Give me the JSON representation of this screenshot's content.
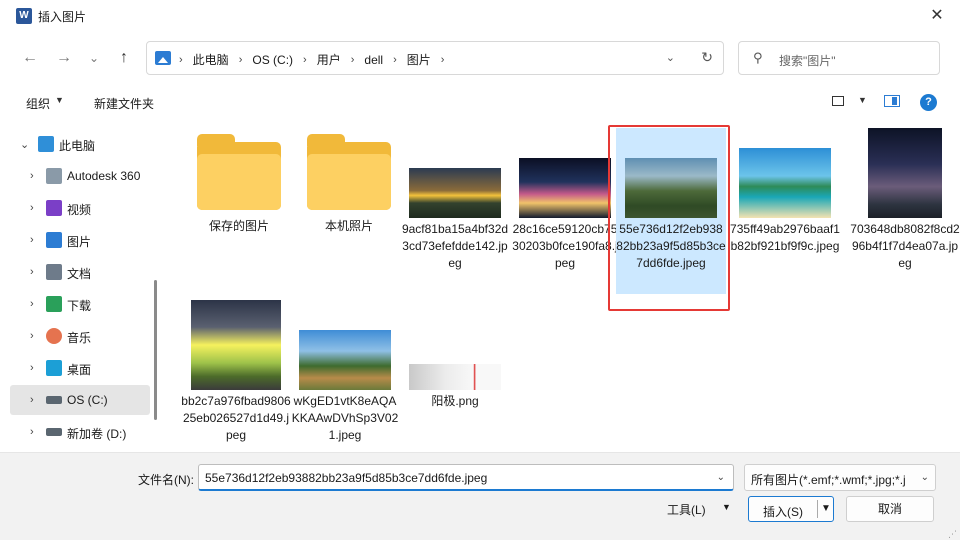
{
  "window": {
    "title": "插入图片",
    "app_icon": "W",
    "close_glyph": "✕"
  },
  "nav": {
    "back_glyph": "←",
    "forward_glyph": "→",
    "recent_glyph": "⌄",
    "up_glyph": "↑",
    "breadcrumb": [
      "此电脑",
      "OS (C:)",
      "用户",
      "dell",
      "图片"
    ],
    "separator": "›",
    "dropdown_glyph": "⌄",
    "refresh_glyph": "↻",
    "search_placeholder": "搜索\"图片\"",
    "search_glyph": "⚲"
  },
  "toolbar": {
    "organize_label": "组织",
    "new_folder_label": "新建文件夹",
    "caret": "▼",
    "help_glyph": "?"
  },
  "sidebar": {
    "items": [
      {
        "label": "此电脑",
        "icon": "monitor-icon",
        "color": "#2f8fd8"
      },
      {
        "label": "Autodesk 360",
        "icon": "cloud-icon",
        "color": "#8a9aa8"
      },
      {
        "label": "视频",
        "icon": "video-icon",
        "color": "#7b3fc7"
      },
      {
        "label": "图片",
        "icon": "picture-icon",
        "color": "#2c7cd3"
      },
      {
        "label": "文档",
        "icon": "document-icon",
        "color": "#6e7b8a"
      },
      {
        "label": "下载",
        "icon": "download-icon",
        "color": "#2aa05a"
      },
      {
        "label": "音乐",
        "icon": "music-icon",
        "color": "#e5734f"
      },
      {
        "label": "桌面",
        "icon": "desktop-icon",
        "color": "#1c9fd6"
      },
      {
        "label": "OS (C:)",
        "icon": "drive-icon",
        "color": "#5a6670"
      },
      {
        "label": "新加卷 (D:)",
        "icon": "drive-icon",
        "color": "#5a6670"
      }
    ],
    "expanded_glyph": "⌄",
    "collapsed_glyph": "›"
  },
  "files": [
    {
      "name": "保存的图片",
      "kind": "folder"
    },
    {
      "name": "本机照片",
      "kind": "folder"
    },
    {
      "name": "9acf81ba15a4bf32d3cd73efefdde142.jpeg",
      "kind": "image"
    },
    {
      "name": "28c16ce59120cb7530203b0fce190fa8.jpeg",
      "kind": "image"
    },
    {
      "name": "55e736d12f2eb93882bb23a9f5d85b3ce7dd6fde.jpeg",
      "kind": "image"
    },
    {
      "name": "735ff49ab2976baaf1b82bf921bf9f9c.jpeg",
      "kind": "image"
    },
    {
      "name": "703648db8082f8cd296b4f1f7d4ea07a.jpeg",
      "kind": "image"
    },
    {
      "name": "bb2c7a976fbad980625eb026527d1d49.jpeg",
      "kind": "image"
    },
    {
      "name": "wKgED1vtK8eAQAKKAAwDVhSp3V021.jpeg",
      "kind": "image"
    },
    {
      "name": "阳极.png",
      "kind": "image"
    }
  ],
  "bottom": {
    "filename_label": "文件名(N):",
    "filename_value": "55e736d12f2eb93882bb23a9f5d85b3ce7dd6fde.jpeg",
    "filetype_value": "所有图片(*.emf;*.wmf;*.jpg;*.j",
    "tools_label": "工具(L)",
    "insert_label": "插入(S)",
    "cancel_label": "取消",
    "dropdown_glyph": "⌄",
    "caret": "▼"
  },
  "colors": {
    "selection": "#cce8ff",
    "accent": "#1c7ad1",
    "highlight_box": "#e53935",
    "folder": "#fdd062"
  }
}
